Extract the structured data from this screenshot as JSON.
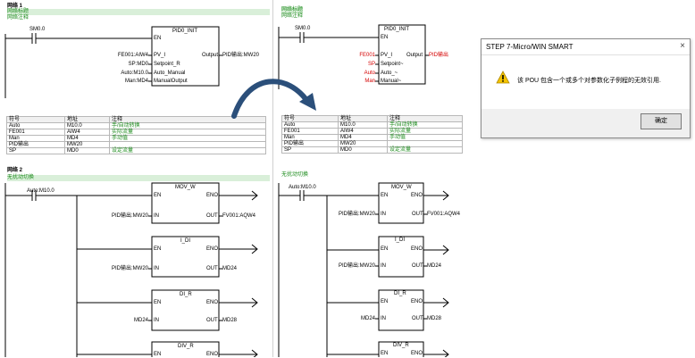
{
  "left": {
    "net1_label": "网络 1",
    "net1_title": "网络标题",
    "net1_comment": "网络注释",
    "contact1": "SM0.0",
    "pid_box_name": "PID0_INIT",
    "en": "EN",
    "pid_left_pins": [
      "PV_I",
      "Setpoint_R",
      "Auto_Manual",
      "ManualOutput"
    ],
    "pid_left_operands": [
      "FE001:AIW4",
      "SP:MD0",
      "Auto:M10.0",
      "Man:MD4"
    ],
    "pid_out_pin": "Output",
    "pid_out_operand": "PID输出:MW20",
    "symbol_table": {
      "headers": [
        "符号",
        "地址",
        "注释"
      ],
      "rows": [
        [
          "Auto",
          "M10.0",
          "手/自动转换"
        ],
        [
          "FE001",
          "AIW4",
          "实际流量"
        ],
        [
          "Man",
          "MD4",
          "手动值"
        ],
        [
          "PID输出",
          "MW20",
          ""
        ],
        [
          "SP",
          "MD0",
          "设定流量"
        ]
      ]
    },
    "net2_label": "网络 2",
    "net2_title": "无扰动切换",
    "contact2": "Auto:M10.0",
    "blocks": [
      {
        "name": "MOV_W",
        "in_op": "PID输出:MW20",
        "out_op": "FV001:AQW4"
      },
      {
        "name": "I_DI",
        "in_op": "PID输出:MW20",
        "out_op": "MD24"
      },
      {
        "name": "DI_R",
        "in_op": "MD24",
        "out_op": "MD28"
      },
      {
        "name": "DIV_R",
        "in_op": "",
        "out_op": ""
      }
    ],
    "pins": {
      "en": "EN",
      "eno": "ENO",
      "in": "IN",
      "out": "OUT"
    }
  },
  "right": {
    "net1_title": "网络标题",
    "net1_comment": "网络注释",
    "contact1": "SM0.0",
    "pid_box_name": "PID0_INIT",
    "en": "EN",
    "pid_left_pins": [
      "PV_I",
      "Setpoint~",
      "Auto_~",
      "Manual~"
    ],
    "pid_left_operands": [
      "FE001",
      "SP",
      "Auto",
      "Man"
    ],
    "pid_out_pin": "Output",
    "pid_out_operand": "PID输出",
    "symbol_table": {
      "headers": [
        "符号",
        "地址",
        "注释"
      ],
      "rows": [
        [
          "Auto",
          "M10.0",
          "手/自动转换"
        ],
        [
          "FE001",
          "AIW4",
          "实际流量"
        ],
        [
          "Man",
          "MD4",
          "手动值"
        ],
        [
          "PID输出",
          "MW20",
          ""
        ],
        [
          "SP",
          "MD0",
          "设定流量"
        ]
      ]
    },
    "net2_title": "无扰动切换",
    "contact2": "Auto:M10.0",
    "blocks": [
      {
        "name": "MOV_W",
        "in_op": "PID输出:MW20",
        "out_op": "FV001:AQW4"
      },
      {
        "name": "I_DI",
        "in_op": "PID输出:MW20",
        "out_op": "MD24"
      },
      {
        "name": "DI_R",
        "in_op": "MD24",
        "out_op": "MD28"
      },
      {
        "name": "DIV_R",
        "in_op": "",
        "out_op": ""
      }
    ]
  },
  "dialog": {
    "title": "STEP 7-Micro/WIN SMART",
    "close": "×",
    "message": "该 POU 包含一个或多个对参数化子例程的无效引用.",
    "ok_label": "确定",
    "icon": "warning-icon"
  },
  "colors": {
    "arrow": "#2b4f7a",
    "comment_green": "#1a8a1a",
    "operand_red": "#d40000"
  }
}
